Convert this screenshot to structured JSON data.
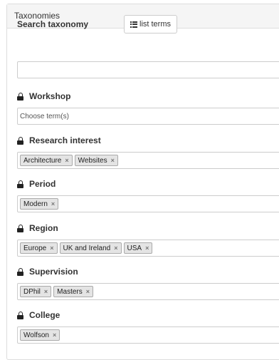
{
  "panel": {
    "title": "Taxonomies"
  },
  "search": {
    "label": "Search taxonomy",
    "button_label": "list terms",
    "button_icon": "list-icon",
    "value": ""
  },
  "fields": {
    "workshop": {
      "label": "Workshop",
      "placeholder": "Choose term(s)",
      "tags": []
    },
    "research": {
      "label": "Research interest",
      "tags": [
        "Architecture",
        "Websites"
      ]
    },
    "period": {
      "label": "Period",
      "tags": [
        "Modern"
      ]
    },
    "region": {
      "label": "Region",
      "tags": [
        "Europe",
        "UK and Ireland",
        "USA"
      ]
    },
    "supervision": {
      "label": "Supervision",
      "tags": [
        "DPhil",
        "Masters"
      ]
    },
    "college": {
      "label": "College",
      "tags": [
        "Wolfson"
      ]
    }
  },
  "tag_remove_glyph": "×",
  "lock_icon": "lock-icon"
}
